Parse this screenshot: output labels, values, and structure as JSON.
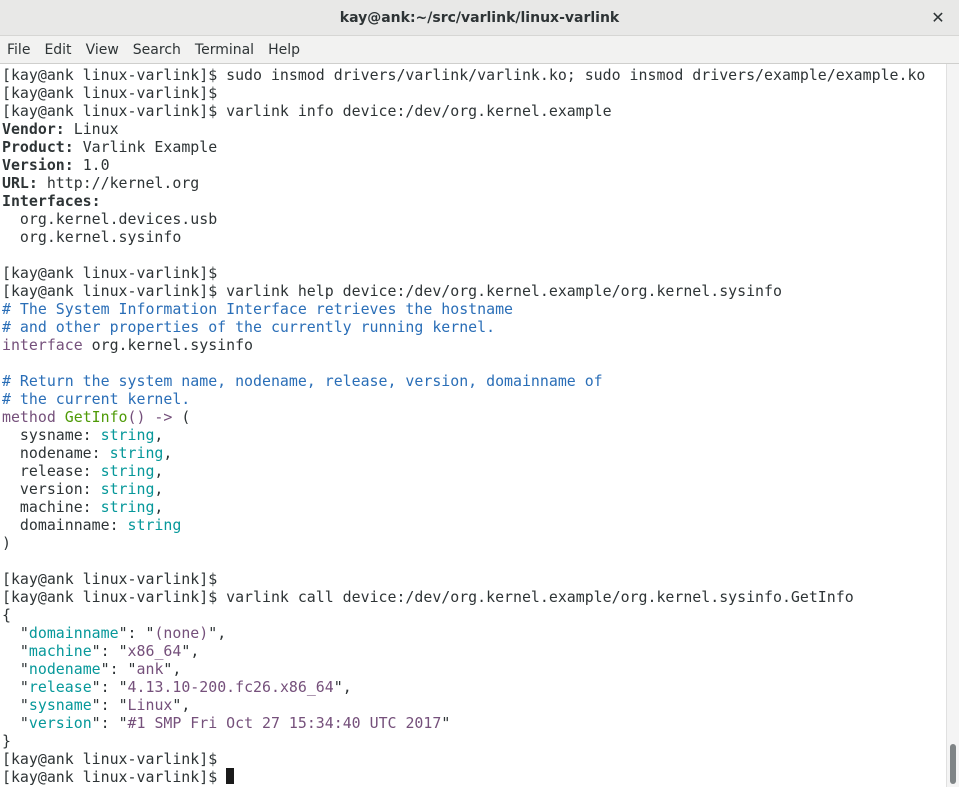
{
  "window": {
    "title": "kay@ank:~/src/varlink/linux-varlink",
    "close_glyph": "✕"
  },
  "menu": [
    "File",
    "Edit",
    "View",
    "Search",
    "Terminal",
    "Help"
  ],
  "prompt": "[kay@ank linux-varlink]$ ",
  "commands": {
    "insmod": "sudo insmod drivers/varlink/varlink.ko; sudo insmod drivers/example/example.ko",
    "info": "varlink info device:/dev/org.kernel.example",
    "help": "varlink help device:/dev/org.kernel.example/org.kernel.sysinfo",
    "call": "varlink call device:/dev/org.kernel.example/org.kernel.sysinfo.GetInfo"
  },
  "info": {
    "vendor": {
      "label": "Vendor:",
      "value": " Linux"
    },
    "product": {
      "label": "Product:",
      "value": " Varlink Example"
    },
    "version": {
      "label": "Version:",
      "value": " 1.0"
    },
    "url": {
      "label": "URL:",
      "value": " http://kernel.org"
    },
    "interfaces_label": "Interfaces:",
    "interfaces": [
      "  org.kernel.devices.usb",
      "  org.kernel.sysinfo"
    ]
  },
  "idl": {
    "comment1": "# The System Information Interface retrieves the hostname",
    "comment2": "# and other properties of the currently running kernel.",
    "interface_kw": "interface",
    "interface_name": " org.kernel.sysinfo",
    "comment3": "# Return the system name, nodename, release, version, domainname of",
    "comment4": "# the current kernel.",
    "method_kw": "method",
    "method_name": "GetInfo",
    "method_parens": "()",
    "arrow": " ->",
    "open_paren": " (",
    "fields": [
      {
        "name": "  sysname:",
        "type": "string",
        "sep": ","
      },
      {
        "name": "  nodename:",
        "type": "string",
        "sep": ","
      },
      {
        "name": "  release:",
        "type": "string",
        "sep": ","
      },
      {
        "name": "  version:",
        "type": "string",
        "sep": ","
      },
      {
        "name": "  machine:",
        "type": "string",
        "sep": ","
      },
      {
        "name": "  domainname:",
        "type": "string",
        "sep": ""
      }
    ],
    "close_paren": ")"
  },
  "result": {
    "open": "{",
    "entries": [
      {
        "key": "domainname",
        "value": "(none)",
        "sep": ","
      },
      {
        "key": "machine",
        "value": "x86_64",
        "sep": ","
      },
      {
        "key": "nodename",
        "value": "ank",
        "sep": ","
      },
      {
        "key": "release",
        "value": "4.13.10-200.fc26.x86_64",
        "sep": ","
      },
      {
        "key": "sysname",
        "value": "Linux",
        "sep": ","
      },
      {
        "key": "version",
        "value": "#1 SMP Fri Oct 27 15:34:40 UTC 2017",
        "sep": ""
      }
    ],
    "close": "}"
  },
  "colors": {
    "comment": "#2a6eb7",
    "keyword": "#75507b",
    "function": "#4e9a06",
    "type": "#06989a",
    "string": "#75507b",
    "text": "#2e3436"
  }
}
